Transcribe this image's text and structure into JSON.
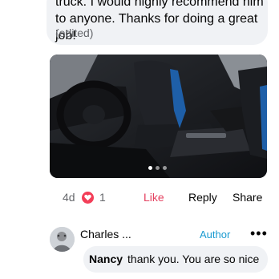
{
  "comment": {
    "text": "truck. I would highly recommend him to anyone. Thanks for doing a great job!",
    "edited": "(edited)"
  },
  "photo": {
    "description_icon": "car-interior-photo",
    "carousel_count": 3,
    "carousel_active": 1
  },
  "actions": {
    "time": "4d",
    "reaction_icon": "heart-icon",
    "reaction_count": "1",
    "like": "Like",
    "reply": "Reply",
    "share": "Share",
    "like_color": "#e4405f"
  },
  "reply": {
    "name_truncated": "Charles ...",
    "badge": "Author",
    "more_icon": "more-options-icon",
    "mention": "Nancy",
    "text": "thank you. You are so nice"
  },
  "colors": {
    "bubble": "#f0f2f5",
    "heart": "#f33e58",
    "author": "#1b9bd1"
  }
}
